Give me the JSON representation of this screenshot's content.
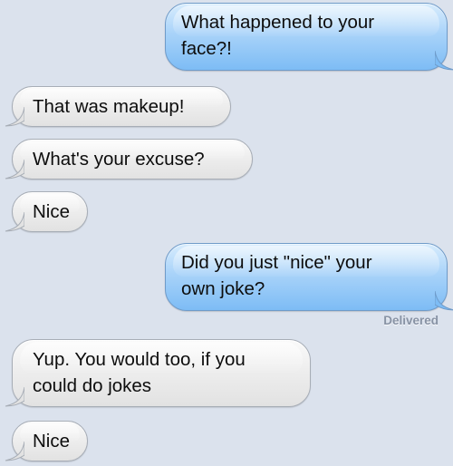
{
  "conversation": {
    "messages": [
      {
        "direction": "outgoing",
        "text": "What happened to your\nface?!"
      },
      {
        "direction": "incoming",
        "text": "That was makeup!"
      },
      {
        "direction": "incoming",
        "text": "What's your excuse?"
      },
      {
        "direction": "incoming",
        "text": "Nice"
      },
      {
        "direction": "outgoing",
        "text": "Did you just \"nice\" your\nown joke?"
      },
      {
        "direction": "incoming",
        "text": "Yup. You would too, if you\ncould do jokes"
      },
      {
        "direction": "incoming",
        "text": "Nice"
      }
    ],
    "delivery_status": "Delivered"
  },
  "colors": {
    "background": "#dbe2ed",
    "incoming_bubble": "#eeeeee",
    "outgoing_bubble": "#a9d3f9",
    "status_text": "#8792a4"
  }
}
